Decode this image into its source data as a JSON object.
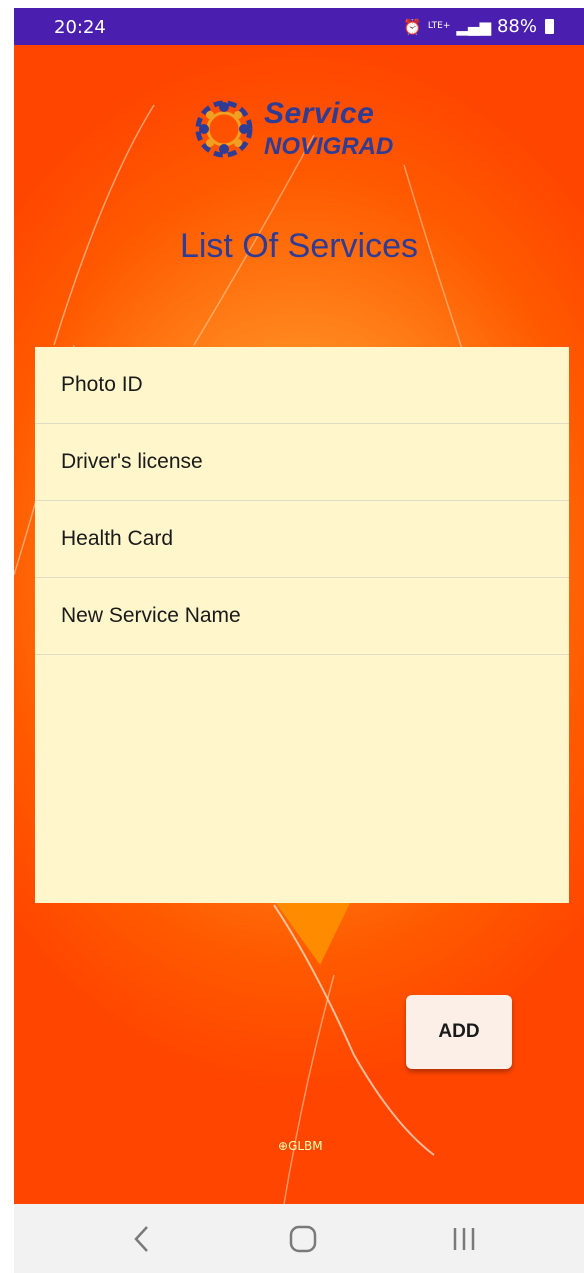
{
  "status_bar": {
    "time": "20:24",
    "network": "LTE+",
    "battery": "88%"
  },
  "app": {
    "logo_line1": "Service",
    "logo_line2": "NOVIGRAD",
    "title": "List Of Services"
  },
  "services": [
    {
      "name": "Photo ID"
    },
    {
      "name": "Driver's license"
    },
    {
      "name": "Health Card"
    },
    {
      "name": "New Service Name"
    }
  ],
  "actions": {
    "add_label": "ADD"
  },
  "footer": {
    "watermark": "GLBM"
  },
  "colors": {
    "status_bar": "#4a1fb0",
    "title": "#2f3c95",
    "list_bg": "#fff6cc",
    "background_primary": "#ff5a00"
  }
}
